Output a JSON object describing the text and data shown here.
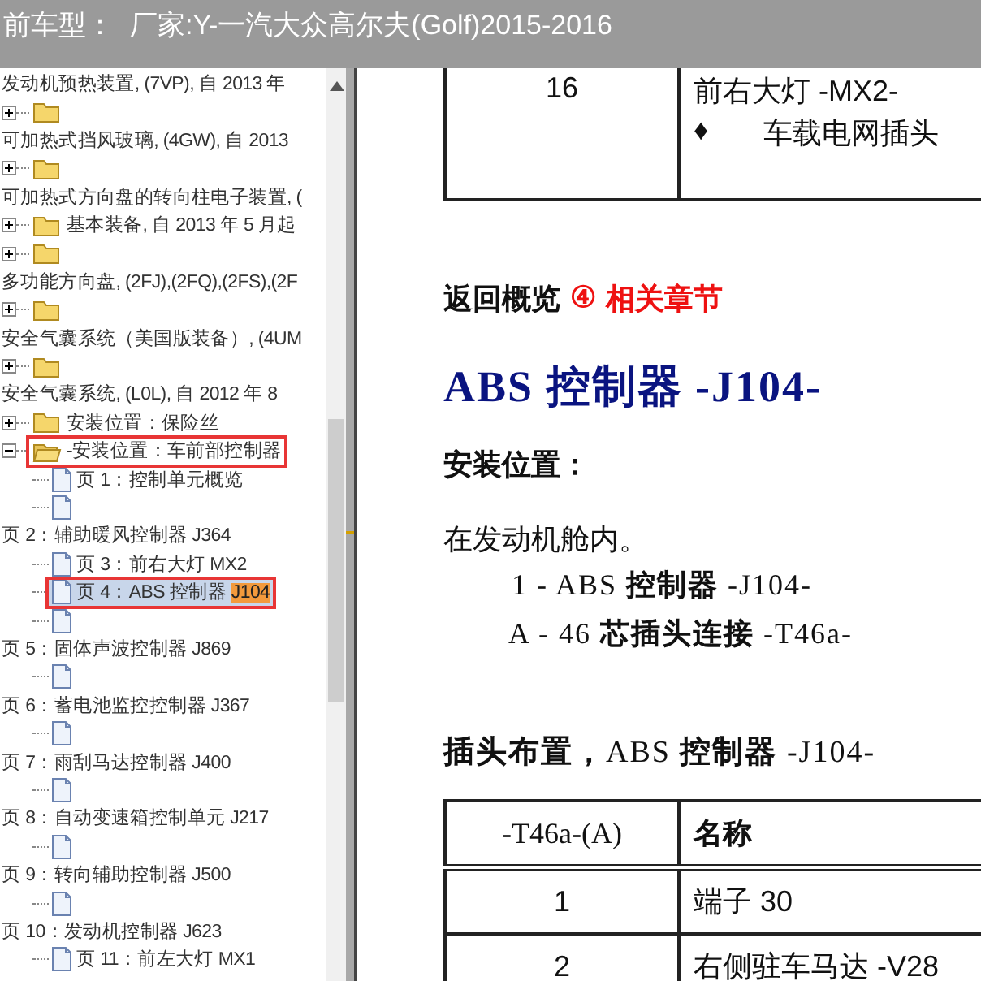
{
  "header": {
    "title_prefix": "前车型：",
    "title": "厂家:Y-一汽大众高尔夫(Golf)2015-2016"
  },
  "tree": {
    "rows": [
      {
        "kind": "label",
        "label": "发动机预热装置, (7VP), 自 2013 年"
      },
      {
        "kind": "folder",
        "expanded": false,
        "selected": false,
        "outlined": false
      },
      {
        "kind": "label",
        "label": "可加热式挡风玻璃, (4GW), 自 2013"
      },
      {
        "kind": "folder",
        "expanded": false,
        "selected": false,
        "outlined": false
      },
      {
        "kind": "label",
        "label": "可加热式方向盘的转向柱电子装置, ("
      },
      {
        "kind": "folder",
        "expanded": false,
        "label": "基本装备, 自 2013 年 5 月起",
        "selected": false,
        "outlined": false
      },
      {
        "kind": "folder",
        "expanded": false,
        "selected": false,
        "outlined": false
      },
      {
        "kind": "label",
        "label": "多功能方向盘, (2FJ),(2FQ),(2FS),(2F"
      },
      {
        "kind": "folder",
        "expanded": false,
        "selected": false,
        "outlined": false
      },
      {
        "kind": "label",
        "label": "安全气囊系统（美国版装备）, (4UM"
      },
      {
        "kind": "folder",
        "expanded": false,
        "selected": false,
        "outlined": false
      },
      {
        "kind": "label",
        "label": "安全气囊系统, (L0L), 自 2012 年 8"
      },
      {
        "kind": "folder",
        "expanded": false,
        "label": "安装位置：保险丝",
        "selected": false,
        "outlined": false
      },
      {
        "kind": "folder",
        "expanded": true,
        "label": "-安装位置：车前部控制器",
        "selected": false,
        "outlined": true
      },
      {
        "kind": "page",
        "label": "页 1：控制单元概览",
        "selected": false,
        "outlined": false
      },
      {
        "kind": "page",
        "selected": false,
        "outlined": false
      },
      {
        "kind": "label",
        "label": "页 2：辅助暖风控制器 J364"
      },
      {
        "kind": "page",
        "label": "页 3：前右大灯 MX2",
        "selected": false,
        "outlined": false
      },
      {
        "kind": "page",
        "label": "页 4：ABS 控制器 ",
        "match": "J104",
        "selected": true,
        "outlined": true
      },
      {
        "kind": "page",
        "selected": false,
        "outlined": false
      },
      {
        "kind": "label",
        "label": "页 5：固体声波控制器 J869"
      },
      {
        "kind": "page",
        "selected": false,
        "outlined": false
      },
      {
        "kind": "label",
        "label": "页 6：蓄电池监控控制器 J367"
      },
      {
        "kind": "page",
        "selected": false,
        "outlined": false
      },
      {
        "kind": "label",
        "label": "页 7：雨刮马达控制器 J400"
      },
      {
        "kind": "page",
        "selected": false,
        "outlined": false
      },
      {
        "kind": "label",
        "label": "页 8：自动变速箱控制单元 J217"
      },
      {
        "kind": "page",
        "selected": false,
        "outlined": false
      },
      {
        "kind": "label",
        "label": "页 9：转向辅助控制器 J500"
      },
      {
        "kind": "page",
        "selected": false,
        "outlined": false
      },
      {
        "kind": "label",
        "label": "页 10：发动机控制器 J623"
      },
      {
        "kind": "page",
        "label": "页 11：前左大灯 MX1",
        "selected": false,
        "outlined": false
      }
    ]
  },
  "document": {
    "top_table": {
      "rows": [
        {
          "number": "16",
          "name": "前右大灯 -MX2-",
          "bullet": "♦",
          "sub_text": "车载电网插头"
        }
      ]
    },
    "back_link": {
      "text": "返回概览",
      "icon": "④",
      "related": "相关章节"
    },
    "title": "ABS 控制器 -J104-",
    "install_heading": "安装位置：",
    "install_text": "在发动机舱内。",
    "legend": [
      "1 - ABS **控制器** -J104-",
      "A - 46 **芯插头连接** -T46a-"
    ],
    "pin_heading": "**插头布置，**ABS **控制器** -J104-",
    "pin_table": {
      "columns": [
        "-T46a-(A)",
        "名称"
      ],
      "rows": [
        [
          "1",
          "端子 30"
        ],
        [
          "2",
          "右侧驻车马达 -V28"
        ]
      ]
    }
  }
}
